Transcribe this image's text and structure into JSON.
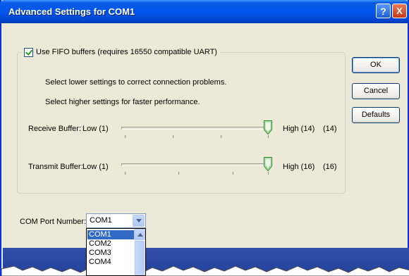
{
  "window": {
    "title": "Advanced Settings for COM1",
    "help_glyph": "?",
    "close_glyph": "X"
  },
  "fifo": {
    "checkbox_label": "Use FIFO buffers (requires 16550 compatible UART)",
    "checked": true,
    "hint_lower": "Select lower settings to correct connection problems.",
    "hint_higher": "Select higher settings for faster performance."
  },
  "receive_buffer": {
    "label": "Receive Buffer:",
    "low_label": "Low (1)",
    "high_label": "High (14)",
    "value_display": "(14)",
    "level": 1.0
  },
  "transmit_buffer": {
    "label": "Transmit Buffer:",
    "low_label": "Low (1)",
    "high_label": "High (16)",
    "value_display": "(16)",
    "level": 1.0
  },
  "buttons": {
    "ok": "OK",
    "cancel": "Cancel",
    "defaults": "Defaults"
  },
  "com_port": {
    "label": "COM Port Number:",
    "selected": "COM1",
    "options": [
      "COM1",
      "COM2",
      "COM3",
      "COM4"
    ]
  },
  "icons": {
    "checkbox": "checkmark-icon",
    "combo_arrow": "chevron-down-icon",
    "scroll_up": "chevron-up-icon",
    "slider_thumb": "slider-thumb-icon"
  },
  "colors": {
    "titlebar": "#0058ee",
    "dialog_bg": "#ece9d8",
    "selection": "#316ac5",
    "bottom_band": "#2f4ea9"
  }
}
